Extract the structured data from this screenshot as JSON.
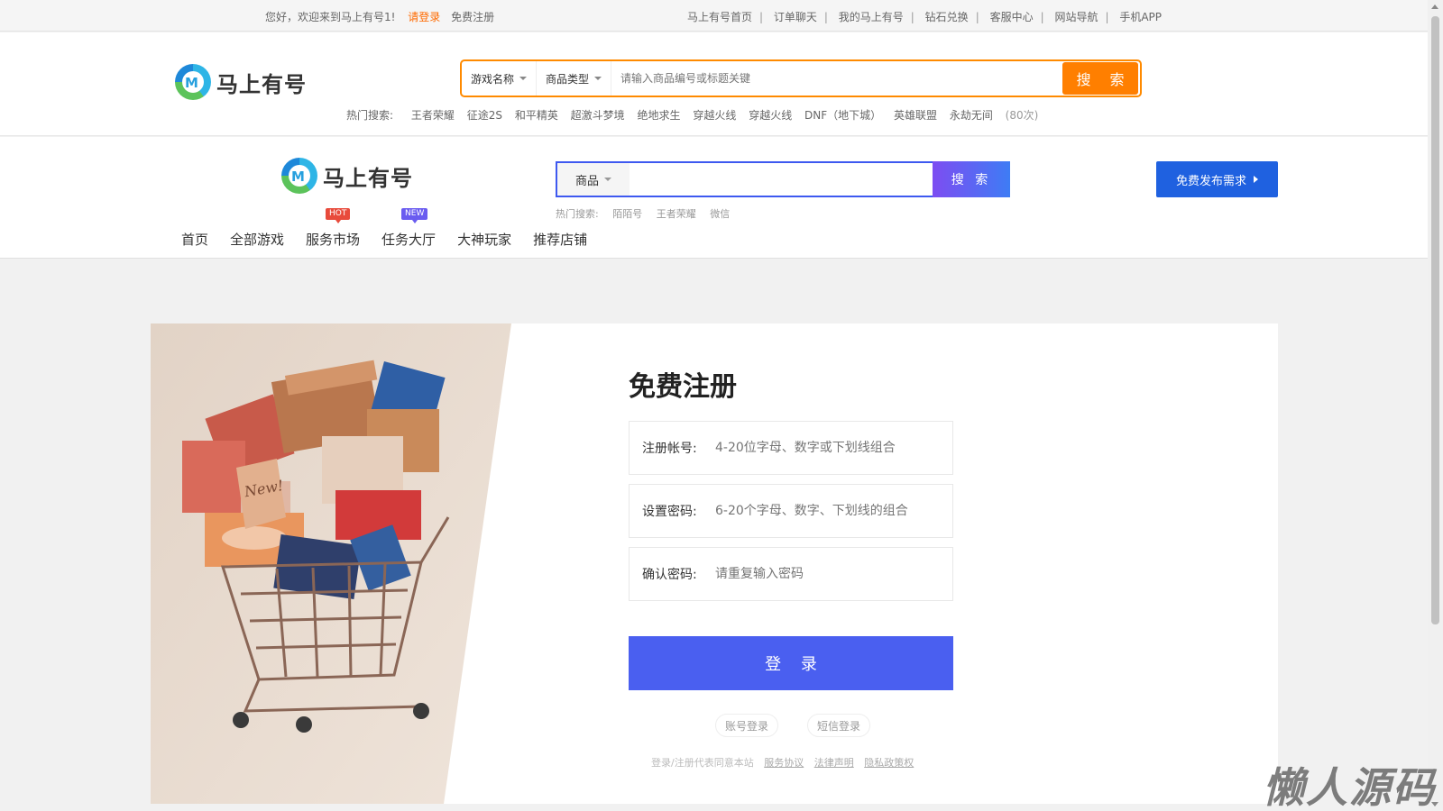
{
  "topbar": {
    "welcome": "您好，欢迎来到马上有号1!",
    "login": "请登录",
    "register": "免费注册",
    "links": [
      "马上有号首页",
      "订单聊天",
      "我的马上有号",
      "钻石兑换",
      "客服中心",
      "网站导航",
      "手机APP"
    ]
  },
  "header1": {
    "logo_text": "马上有号",
    "game_dropdown": "游戏名称",
    "type_dropdown": "商品类型",
    "search_placeholder": "请输入商品编号或标题关键",
    "search_button": "搜 索",
    "hot_label": "热门搜索:",
    "hot_items": [
      "王者荣耀",
      "征途2S",
      "和平精英",
      "超激斗梦境",
      "绝地求生",
      "穿越火线",
      "穿越火线",
      "DNF（地下城）",
      "英雄联盟",
      "永劫无间"
    ],
    "hot_count": "(80次)"
  },
  "header2": {
    "logo_text": "马上有号",
    "category": "商品",
    "search_button": "搜 索",
    "hot_label": "热门搜索:",
    "hot_items": [
      "陌陌号",
      "王者荣耀",
      "微信"
    ],
    "publish_button": "免费发布需求",
    "nav": [
      {
        "label": "首页",
        "badge": ""
      },
      {
        "label": "全部游戏",
        "badge": ""
      },
      {
        "label": "服务市场",
        "badge": "HOT"
      },
      {
        "label": "任务大厅",
        "badge": "NEW"
      },
      {
        "label": "大神玩家",
        "badge": ""
      },
      {
        "label": "推荐店铺",
        "badge": ""
      }
    ]
  },
  "form": {
    "title": "免费注册",
    "account_label": "注册帐号:",
    "account_placeholder": "4-20位字母、数字或下划线组合",
    "password_label": "设置密码:",
    "password_placeholder": "6-20个字母、数字、下划线的组合",
    "confirm_label": "确认密码:",
    "confirm_placeholder": "请重复输入密码",
    "submit": "登 录",
    "account_login": "账号登录",
    "sms_login": "短信登录",
    "agree_text": "登录/注册代表同意本站",
    "service_agreement": "服务协议",
    "legal_notice": "法律声明",
    "privacy_policy": "隐私政策权"
  },
  "illustration": {
    "tag_text": "New!"
  },
  "colors": {
    "orange": "#ff7f00",
    "blue": "#4a5ff0",
    "publish_blue": "#1f61e0"
  },
  "watermark": "懒人源码"
}
